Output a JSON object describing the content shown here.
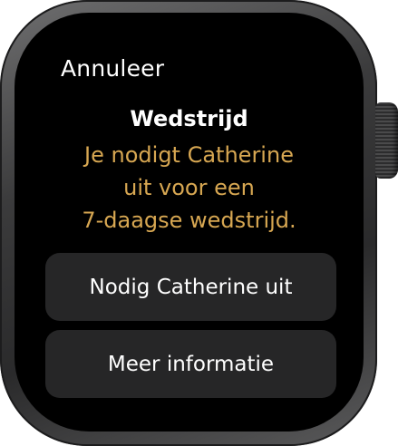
{
  "header": {
    "cancel_label": "Annuleer"
  },
  "alert": {
    "title": "Wedstrijd",
    "message_lines": [
      "Je nodigt Catherine",
      "uit voor een",
      "7-daagse wedstrijd."
    ]
  },
  "actions": {
    "invite_label": "Nodig Catherine uit",
    "more_info_label": "Meer informatie"
  },
  "colors": {
    "message_accent": "#d7a752",
    "button_background": "#262627",
    "screen_background": "#000000"
  }
}
